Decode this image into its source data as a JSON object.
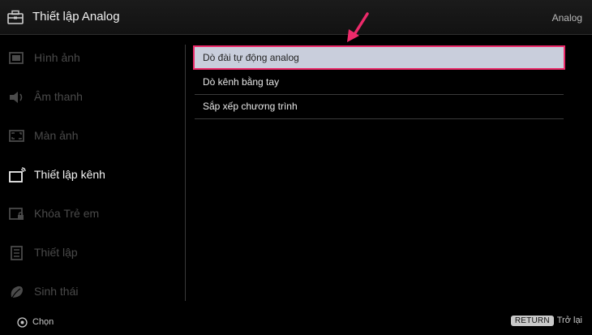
{
  "header": {
    "title": "Thiết lập Analog",
    "mode": "Analog",
    "icon": "toolbox-icon"
  },
  "sidebar": {
    "items": [
      {
        "label": "Hình ảnh",
        "icon": "picture-icon",
        "active": false
      },
      {
        "label": "Âm thanh",
        "icon": "speaker-icon",
        "active": false
      },
      {
        "label": "Màn ảnh",
        "icon": "screen-icon",
        "active": false
      },
      {
        "label": "Thiết lập kênh",
        "icon": "channel-setup-icon",
        "active": true
      },
      {
        "label": "Khóa Trẻ em",
        "icon": "parental-lock-icon",
        "active": false
      },
      {
        "label": "Thiết lập",
        "icon": "settings-icon",
        "active": false
      },
      {
        "label": "Sinh thái",
        "icon": "eco-leaf-icon",
        "active": false
      }
    ]
  },
  "menu": {
    "items": [
      {
        "label": "Dò đài tự động analog",
        "selected": true
      },
      {
        "label": "Dò kênh bằng tay",
        "selected": false
      },
      {
        "label": "Sắp xếp chương trình",
        "selected": false
      }
    ]
  },
  "footer": {
    "select_label": "Chọn",
    "return_key": "RETURN",
    "back_label": "Trở lại"
  },
  "colors": {
    "highlight_bg": "#c9cedc",
    "highlight_border": "#ec2a6a",
    "annotation_arrow": "#ec2a6a",
    "inactive_text": "#4a4a4a"
  }
}
